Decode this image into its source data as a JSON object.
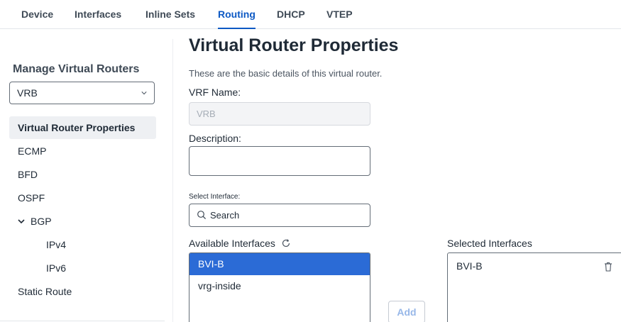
{
  "tabs": [
    {
      "label": "Device"
    },
    {
      "label": "Interfaces"
    },
    {
      "label": "Inline Sets"
    },
    {
      "label": "Routing",
      "active": true
    },
    {
      "label": "DHCP"
    },
    {
      "label": "VTEP"
    }
  ],
  "sidebar": {
    "title": "Manage Virtual Routers",
    "router_select": {
      "value": "VRB",
      "icon": "chevron-down-icon"
    },
    "items": [
      {
        "label": "Virtual Router Properties",
        "active": true
      },
      {
        "label": "ECMP"
      },
      {
        "label": "BFD"
      },
      {
        "label": "OSPF"
      },
      {
        "label": "BGP",
        "expanded": true,
        "icon": "chevron-down-icon"
      },
      {
        "label": "IPv4"
      },
      {
        "label": "IPv6"
      },
      {
        "label": "Static Route"
      }
    ]
  },
  "main": {
    "title": "Virtual Router Properties",
    "subtitle": "These are the basic details of this virtual router.",
    "vrf_name": {
      "label": "VRF Name:",
      "value": "VRB"
    },
    "description": {
      "label": "Description:",
      "value": ""
    },
    "select_interface": {
      "label": "Select Interface:",
      "search_placeholder": "Search",
      "icon": "search-icon"
    },
    "available": {
      "label": "Available Interfaces",
      "refresh_icon": "refresh-icon",
      "items": [
        {
          "label": "BVI-B",
          "selected": true
        },
        {
          "label": "vrg-inside"
        }
      ]
    },
    "add_label": "Add",
    "selected": {
      "label": "Selected Interfaces",
      "items": [
        {
          "label": "BVI-B",
          "icon": "trash-icon"
        }
      ]
    }
  },
  "colors": {
    "accent": "#0d59c4",
    "list_selected_bg": "#2b6bd6",
    "add_button_text": "#97b7e8",
    "text": "#1f2a36"
  }
}
